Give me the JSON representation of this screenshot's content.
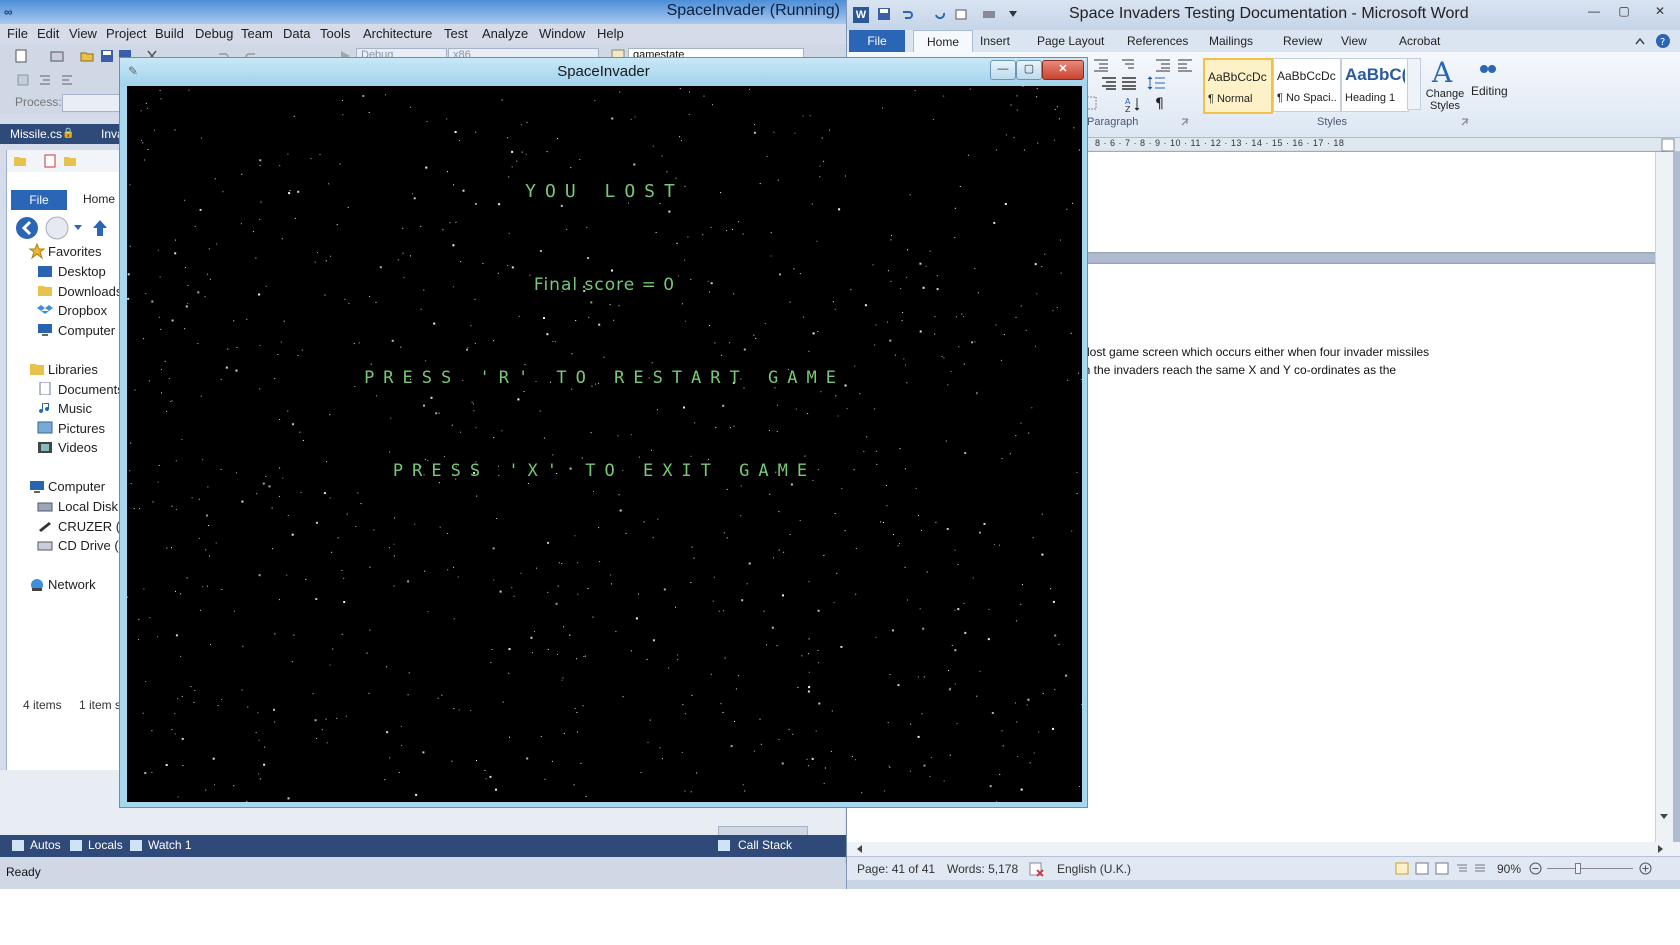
{
  "visual_studio": {
    "title": "SpaceInvader (Running)",
    "menu": [
      "File",
      "Edit",
      "View",
      "Project",
      "Build",
      "Debug",
      "Team",
      "Data",
      "Tools",
      "Architecture",
      "Test",
      "Analyze",
      "Window",
      "Help"
    ],
    "config_dropdown": "Debug",
    "platform_dropdown": "x86",
    "find_box": "gamestate",
    "process_label": "Process:",
    "doc_tabs": [
      "Missile.cs",
      "Inva"
    ],
    "bottom_tabs": [
      "Autos",
      "Locals",
      "Watch 1",
      "Call Stack"
    ],
    "status": "Ready"
  },
  "explorer": {
    "ribbon_file": "File",
    "ribbon_home": "Home",
    "favorites_header": "Favorites",
    "favorites": [
      "Desktop",
      "Downloads",
      "Dropbox",
      "Computer"
    ],
    "libraries_header": "Libraries",
    "libraries": [
      "Documents",
      "Music",
      "Pictures",
      "Videos"
    ],
    "computer_header": "Computer",
    "drives": [
      "Local Disk (C",
      "CRUZER (E:)",
      "CD Drive (F:)"
    ],
    "network": "Network",
    "item_count": "4 items",
    "selected": "1 item se"
  },
  "word": {
    "title": "Space Invaders Testing Documentation  -  Microsoft Word",
    "file_tab": "File",
    "tabs": [
      "Home",
      "Insert",
      "Page Layout",
      "References",
      "Mailings",
      "Review",
      "View",
      "Acrobat"
    ],
    "styles": [
      {
        "sample": "AaBbCcDc",
        "name": "¶ Normal"
      },
      {
        "sample": "AaBbCcDc",
        "name": "¶ No Spaci..."
      },
      {
        "sample": "AaBbC(",
        "name": "Heading 1"
      }
    ],
    "change_styles": "Change Styles",
    "editing": "Editing",
    "group_paragraph": "Paragraph",
    "group_styles": "Styles",
    "ruler": "8 · 6 · 7 · 8 · 9 · 10 · 11 · 12 · 13 · 14 · 15 · 16 · 17 · 18",
    "doc_line1": "e lost game screen which occurs either when four invader missiles",
    "doc_line2": "en the invaders reach the same X and Y co-ordinates as the",
    "status_page": "Page: 41 of 41",
    "status_words": "Words: 5,178",
    "status_lang": "English (U.K.)",
    "zoom": "90%"
  },
  "game": {
    "title": "SpaceInvader",
    "lost_text": "YOU LOST",
    "score_text": "Final score = 0",
    "restart_text": "PRESS 'R' TO RESTART GAME",
    "exit_text": "PRESS 'X' TO EXIT GAME",
    "text_color": "#77c977"
  }
}
